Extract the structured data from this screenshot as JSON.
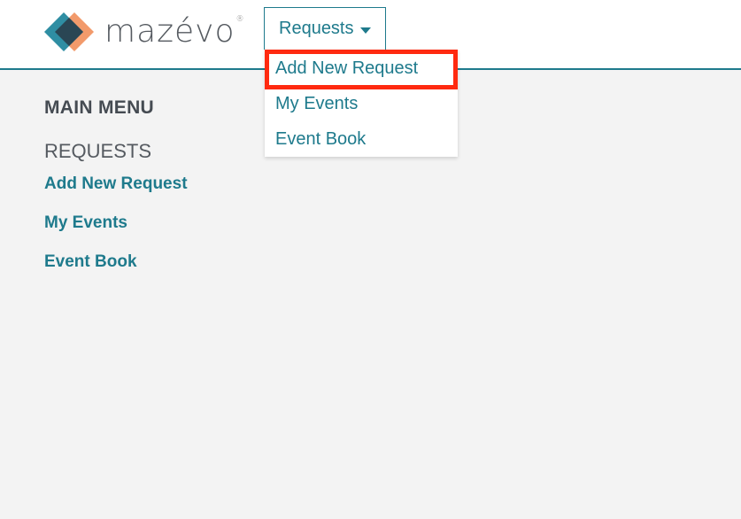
{
  "brand": {
    "name": "mazévo",
    "registered_mark": "®",
    "logo_colors": [
      "#2f8ea3",
      "#f29a6b",
      "#2a4654"
    ]
  },
  "header": {
    "requests_button_label": "Requests",
    "requests_icon": "caret-down-icon"
  },
  "dropdown": {
    "items": [
      {
        "label": "Add New Request"
      },
      {
        "label": "My Events"
      },
      {
        "label": "Event Book"
      }
    ],
    "highlight_color": "#ff2a10"
  },
  "sidebar": {
    "title": "MAIN MENU",
    "section": "REQUESTS",
    "links": [
      {
        "label": "Add New Request"
      },
      {
        "label": "My Events"
      },
      {
        "label": "Event Book"
      }
    ]
  },
  "theme": {
    "accent": "#1e7a8c",
    "background": "#f3f3f3"
  }
}
